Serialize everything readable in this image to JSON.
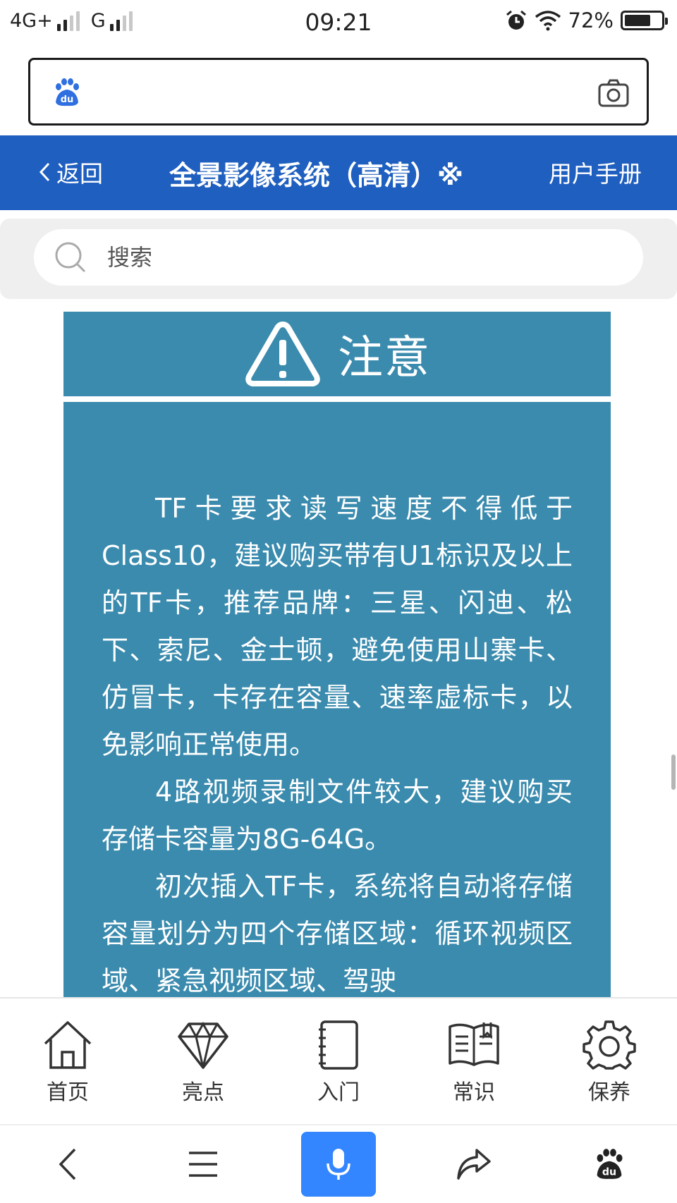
{
  "status_bar": {
    "network1": "4G+",
    "network2": "G",
    "time": "09:21",
    "battery_text": "72%",
    "battery_level": 0.72,
    "icons": [
      "signal-icon",
      "alarm-icon",
      "wifi-icon",
      "battery-icon"
    ]
  },
  "address_bar": {
    "url_value": "",
    "logo_icon": "baidu-paw-icon",
    "camera_icon": "camera-icon"
  },
  "header": {
    "back_label": "返回",
    "title": "全景影像系统（高清）※",
    "manual_label": "用户手册",
    "bg_color": "#1f5fbf"
  },
  "search": {
    "placeholder": "搜索",
    "value": ""
  },
  "notice": {
    "title": "注意",
    "accent_color": "#3a8bae",
    "paragraphs": [
      "TF卡要求读写速度不得低于Class10，建议购买带有U1标识及以上的TF卡，推荐品牌：三星、闪迪、松下、索尼、金士顿，避免使用山寨卡、仿冒卡，卡存在容量、速率虚标卡，以免影响正常使用。",
      "4路视频录制文件较大，建议购买存储卡容量为8G-64G。",
      "初次插入TF卡，系统将自动将存储容量划分为四个存储区域：循环视频区域、紧急视频区域、驾驶"
    ]
  },
  "bottom_nav": {
    "items": [
      {
        "label": "首页",
        "icon": "home-icon"
      },
      {
        "label": "亮点",
        "icon": "diamond-icon"
      },
      {
        "label": "入门",
        "icon": "notebook-icon"
      },
      {
        "label": "常识",
        "icon": "book-icon"
      },
      {
        "label": "保养",
        "icon": "gear-icon"
      }
    ]
  },
  "browser_toolbar": {
    "buttons": [
      "back-icon",
      "menu-icon",
      "microphone-icon",
      "share-icon",
      "baidu-paw-icon"
    ],
    "mic_color": "#3386ff"
  }
}
